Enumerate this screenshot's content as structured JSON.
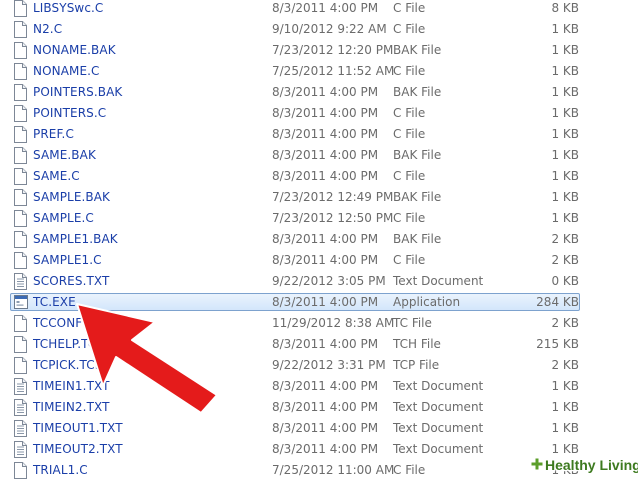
{
  "files": [
    {
      "name": "LIBSYSwc.C",
      "date": "8/3/2011 4:00 PM",
      "type": "C File",
      "size": "8 KB",
      "icon": "file-icon"
    },
    {
      "name": "N2.C",
      "date": "9/10/2012 9:22 AM",
      "type": "C File",
      "size": "1 KB",
      "icon": "file-icon"
    },
    {
      "name": "NONAME.BAK",
      "date": "7/23/2012 12:20 PM",
      "type": "BAK File",
      "size": "1 KB",
      "icon": "file-icon"
    },
    {
      "name": "NONAME.C",
      "date": "7/25/2012 11:52 AM",
      "type": "C File",
      "size": "1 KB",
      "icon": "file-icon"
    },
    {
      "name": "POINTERS.BAK",
      "date": "8/3/2011 4:00 PM",
      "type": "BAK File",
      "size": "1 KB",
      "icon": "file-icon"
    },
    {
      "name": "POINTERS.C",
      "date": "8/3/2011 4:00 PM",
      "type": "C File",
      "size": "1 KB",
      "icon": "file-icon"
    },
    {
      "name": "PREF.C",
      "date": "8/3/2011 4:00 PM",
      "type": "C File",
      "size": "1 KB",
      "icon": "file-icon"
    },
    {
      "name": "SAME.BAK",
      "date": "8/3/2011 4:00 PM",
      "type": "BAK File",
      "size": "1 KB",
      "icon": "file-icon"
    },
    {
      "name": "SAME.C",
      "date": "8/3/2011 4:00 PM",
      "type": "C File",
      "size": "1 KB",
      "icon": "file-icon"
    },
    {
      "name": "SAMPLE.BAK",
      "date": "7/23/2012 12:49 PM",
      "type": "BAK File",
      "size": "1 KB",
      "icon": "file-icon"
    },
    {
      "name": "SAMPLE.C",
      "date": "7/23/2012 12:50 PM",
      "type": "C File",
      "size": "1 KB",
      "icon": "file-icon"
    },
    {
      "name": "SAMPLE1.BAK",
      "date": "8/3/2011 4:00 PM",
      "type": "BAK File",
      "size": "2 KB",
      "icon": "file-icon"
    },
    {
      "name": "SAMPLE1.C",
      "date": "8/3/2011 4:00 PM",
      "type": "C File",
      "size": "2 KB",
      "icon": "file-icon"
    },
    {
      "name": "SCORES.TXT",
      "date": "9/22/2012 3:05 PM",
      "type": "Text Document",
      "size": "0 KB",
      "icon": "text-document-icon"
    },
    {
      "name": "TC.EXE",
      "date": "8/3/2011 4:00 PM",
      "type": "Application",
      "size": "284 KB",
      "icon": "application-icon",
      "selected": true
    },
    {
      "name": "TCCONFI",
      "date": "11/29/2012 8:38 AM",
      "type": "TC File",
      "size": "2 KB",
      "icon": "file-icon"
    },
    {
      "name": "TCHELP.TC",
      "date": "8/3/2011 4:00 PM",
      "type": "TCH File",
      "size": "215 KB",
      "icon": "file-icon"
    },
    {
      "name": "TCPICK.TCP",
      "date": "9/22/2012 3:31 PM",
      "type": "TCP File",
      "size": "2 KB",
      "icon": "file-icon"
    },
    {
      "name": "TIMEIN1.TXT",
      "date": "8/3/2011 4:00 PM",
      "type": "Text Document",
      "size": "1 KB",
      "icon": "text-document-icon"
    },
    {
      "name": "TIMEIN2.TXT",
      "date": "8/3/2011 4:00 PM",
      "type": "Text Document",
      "size": "1 KB",
      "icon": "text-document-icon"
    },
    {
      "name": "TIMEOUT1.TXT",
      "date": "8/3/2011 4:00 PM",
      "type": "Text Document",
      "size": "1 KB",
      "icon": "text-document-icon"
    },
    {
      "name": "TIMEOUT2.TXT",
      "date": "8/3/2011 4:00 PM",
      "type": "Text Document",
      "size": "1 KB",
      "icon": "text-document-icon"
    },
    {
      "name": "TRIAL1.C",
      "date": "7/25/2012 11:00 AM",
      "type": "C File",
      "size": "1 KB",
      "icon": "file-icon"
    }
  ],
  "watermark": {
    "text": "Healthy Living",
    "color": "#5b9e2a"
  },
  "annotation": {
    "color": "#e41b1b"
  }
}
